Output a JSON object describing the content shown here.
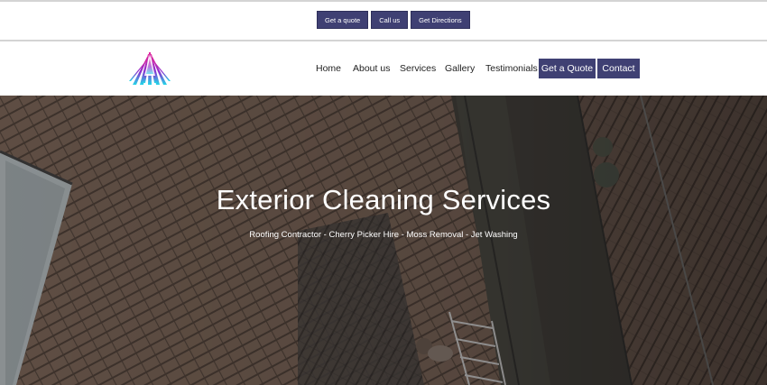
{
  "topbar": {
    "buttons": [
      "Get a quote",
      "Call us",
      "Get Directions"
    ]
  },
  "header": {
    "logo_icon": "triangle-sunburst-logo",
    "nav": [
      "Home",
      "About us",
      "Services",
      "Gallery",
      "Testimonials"
    ],
    "quote_button": "Get a Quote",
    "contact_button": "Contact"
  },
  "hero": {
    "title": "Exterior Cleaning Services",
    "subtitle": "Roofing Contractor - Cherry Picker Hire - Moss Removal - Jet Washing"
  },
  "colors": {
    "button_bg": "#3f4073",
    "logo_pink": "#e0219a",
    "logo_cyan": "#22d8e8",
    "logo_purple": "#7b2fd1"
  }
}
